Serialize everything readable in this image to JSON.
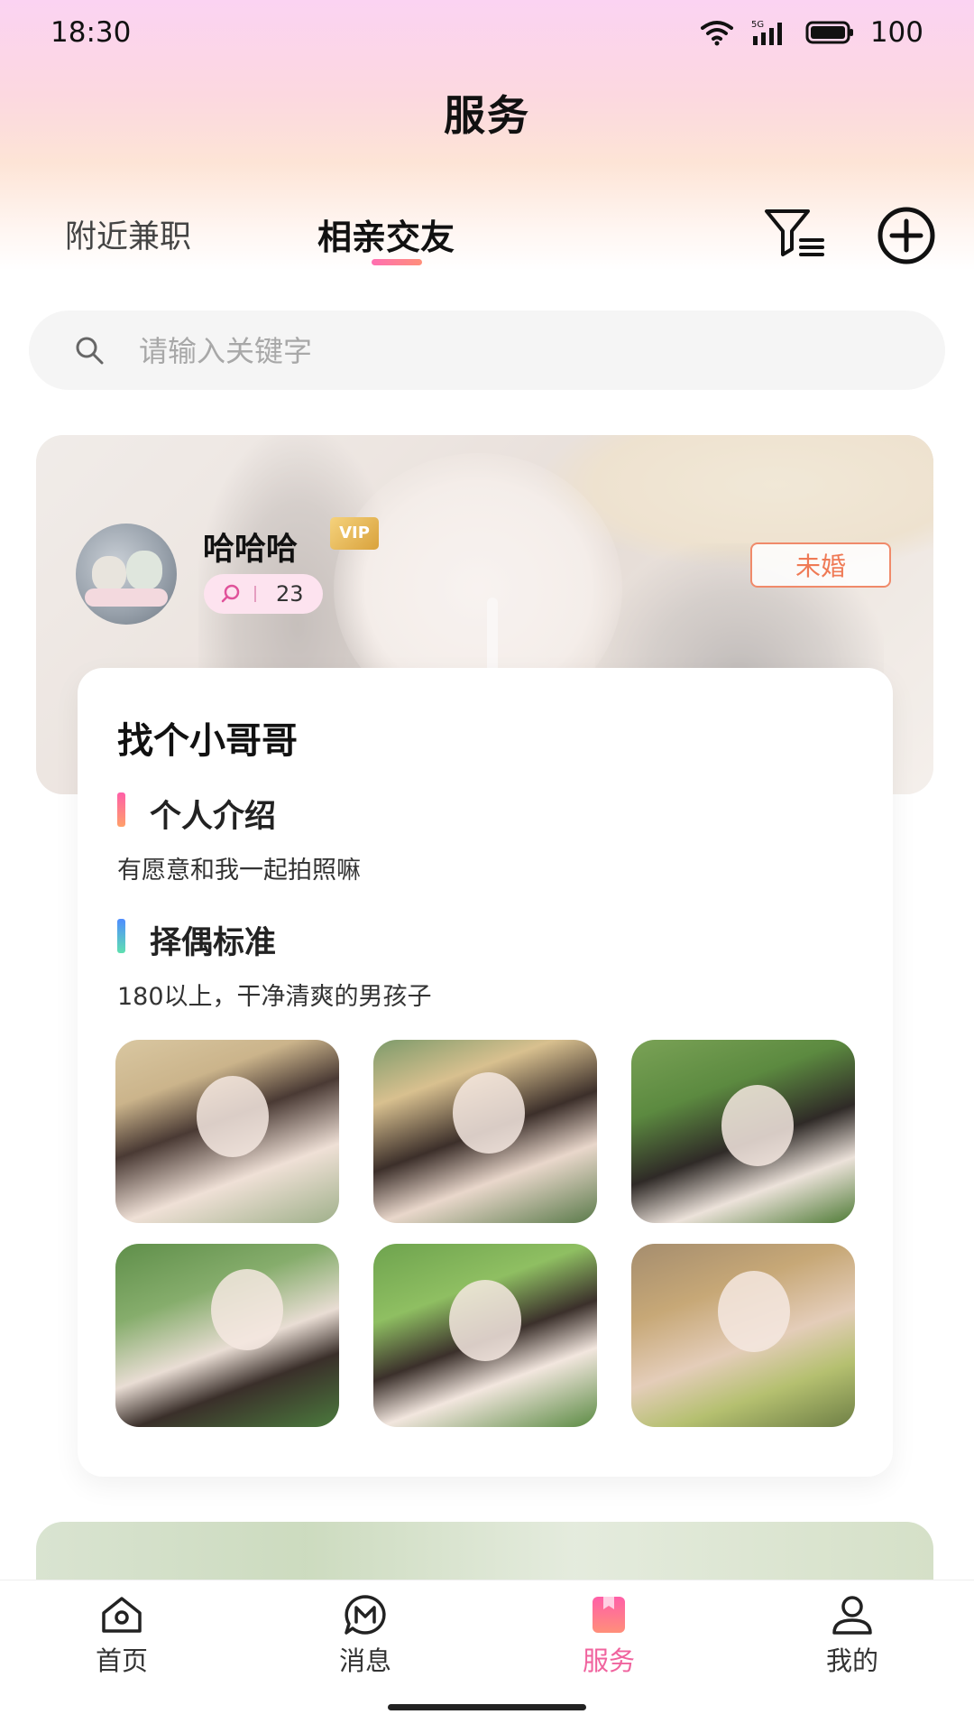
{
  "status_bar": {
    "time": "18:30",
    "network": "5G",
    "battery": "100"
  },
  "header": {
    "title": "服务",
    "tabs": [
      {
        "label": "附近兼职",
        "active": false
      },
      {
        "label": "相亲交友",
        "active": true
      }
    ],
    "icons": [
      "filter-icon",
      "add-circle-icon"
    ]
  },
  "search": {
    "placeholder": "请输入关键字",
    "value": ""
  },
  "post": {
    "user_name": "哈哈哈",
    "vip_label": "VIP",
    "comment_count": "23",
    "marital_status": "未婚",
    "title": "找个小哥哥",
    "sections": [
      {
        "heading": "个人介绍",
        "text": "有愿意和我一起拍照嘛"
      },
      {
        "heading": "择偶标准",
        "text": "180以上，干净清爽的男孩子"
      }
    ],
    "photo_count": 6
  },
  "bottom_nav": {
    "items": [
      {
        "label": "首页",
        "icon": "home-icon",
        "active": false
      },
      {
        "label": "消息",
        "icon": "message-icon",
        "active": false
      },
      {
        "label": "服务",
        "icon": "service-icon",
        "active": true
      },
      {
        "label": "我的",
        "icon": "profile-icon",
        "active": false
      }
    ]
  },
  "colors": {
    "accent": "#f0639e",
    "badge_border": "#f08a6a",
    "vip_gold": "#d9a23c"
  }
}
